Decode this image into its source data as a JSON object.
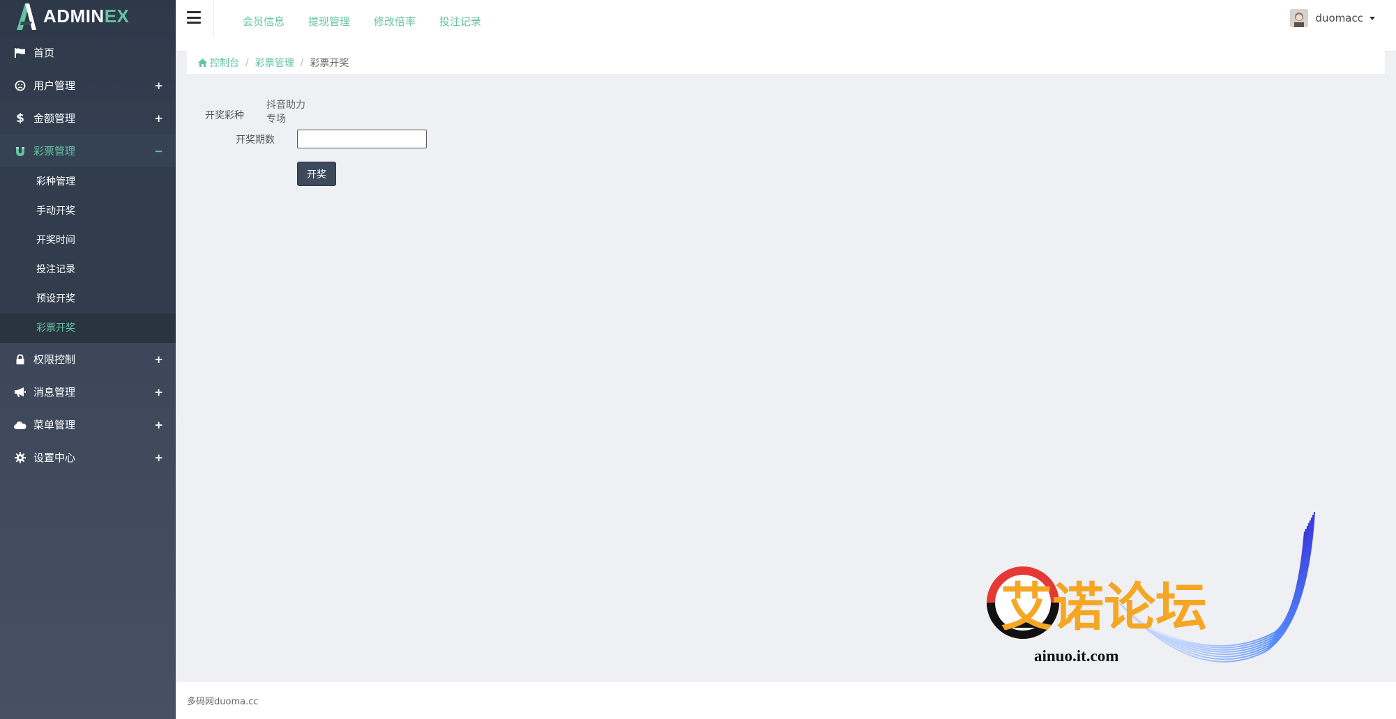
{
  "brand": {
    "part1": "ADMIN",
    "part2": "EX"
  },
  "colors": {
    "accent": "#65c3a0",
    "sidebar_bg": "#3b4759",
    "button_bg": "#3d4a5c"
  },
  "sidebar": {
    "items": [
      {
        "label": "首页",
        "icon": "flag-icon",
        "expand": ""
      },
      {
        "label": "用户管理",
        "icon": "face-icon",
        "expand": "+"
      },
      {
        "label": "金额管理",
        "icon": "dollar-icon",
        "expand": "+"
      },
      {
        "label": "彩票管理",
        "icon": "magnet-icon",
        "expand": "−"
      },
      {
        "label": "权限控制",
        "icon": "lock-icon",
        "expand": "+"
      },
      {
        "label": "消息管理",
        "icon": "megaphone-icon",
        "expand": "+"
      },
      {
        "label": "菜单管理",
        "icon": "cloud-icon",
        "expand": "+"
      },
      {
        "label": "设置中心",
        "icon": "gear-icon",
        "expand": "+"
      }
    ],
    "submenu": [
      {
        "label": "彩种管理"
      },
      {
        "label": "手动开奖"
      },
      {
        "label": "开奖时间"
      },
      {
        "label": "投注记录"
      },
      {
        "label": "预设开奖"
      },
      {
        "label": "彩票开奖"
      }
    ],
    "active_submenu": "彩票开奖"
  },
  "topnav": [
    "会员信息",
    "提现管理",
    "修改倍率",
    "投注记录"
  ],
  "user": {
    "name": "duomacc"
  },
  "breadcrumb": {
    "home": "控制台",
    "section": "彩票管理",
    "current": "彩票开奖",
    "separator": "/"
  },
  "form": {
    "type_label": "开奖彩种",
    "type_value": "抖音助力专场",
    "period_label": "开奖期数",
    "period_value": "",
    "period_placeholder": "",
    "submit_label": "开奖"
  },
  "watermark": {
    "title": "艾诺论坛",
    "site": "ainuo.it.com"
  },
  "footer": {
    "text": "多码网duoma.cc"
  }
}
